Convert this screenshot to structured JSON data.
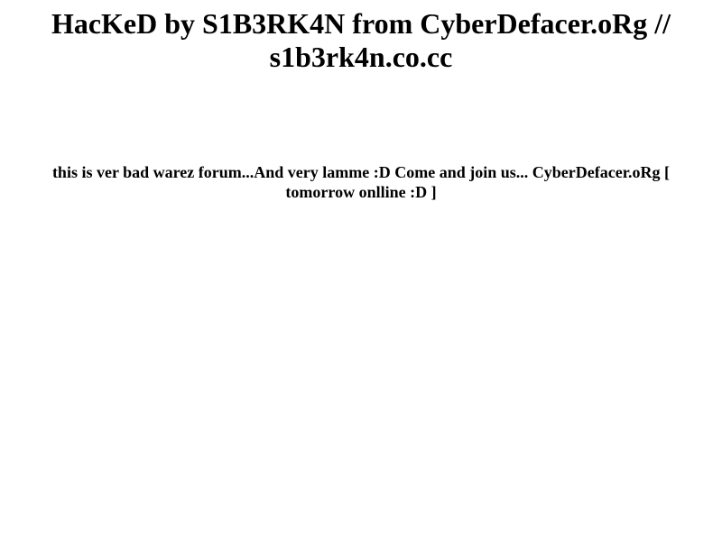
{
  "page": {
    "headline": "HacKeD by S1B3RK4N from CyberDefacer.oRg // s1b3rk4n.co.cc",
    "message": "this is ver bad warez forum...And very lamme :D Come and join us... CyberDefacer.oRg [ tomorrow onlline :D ]"
  }
}
